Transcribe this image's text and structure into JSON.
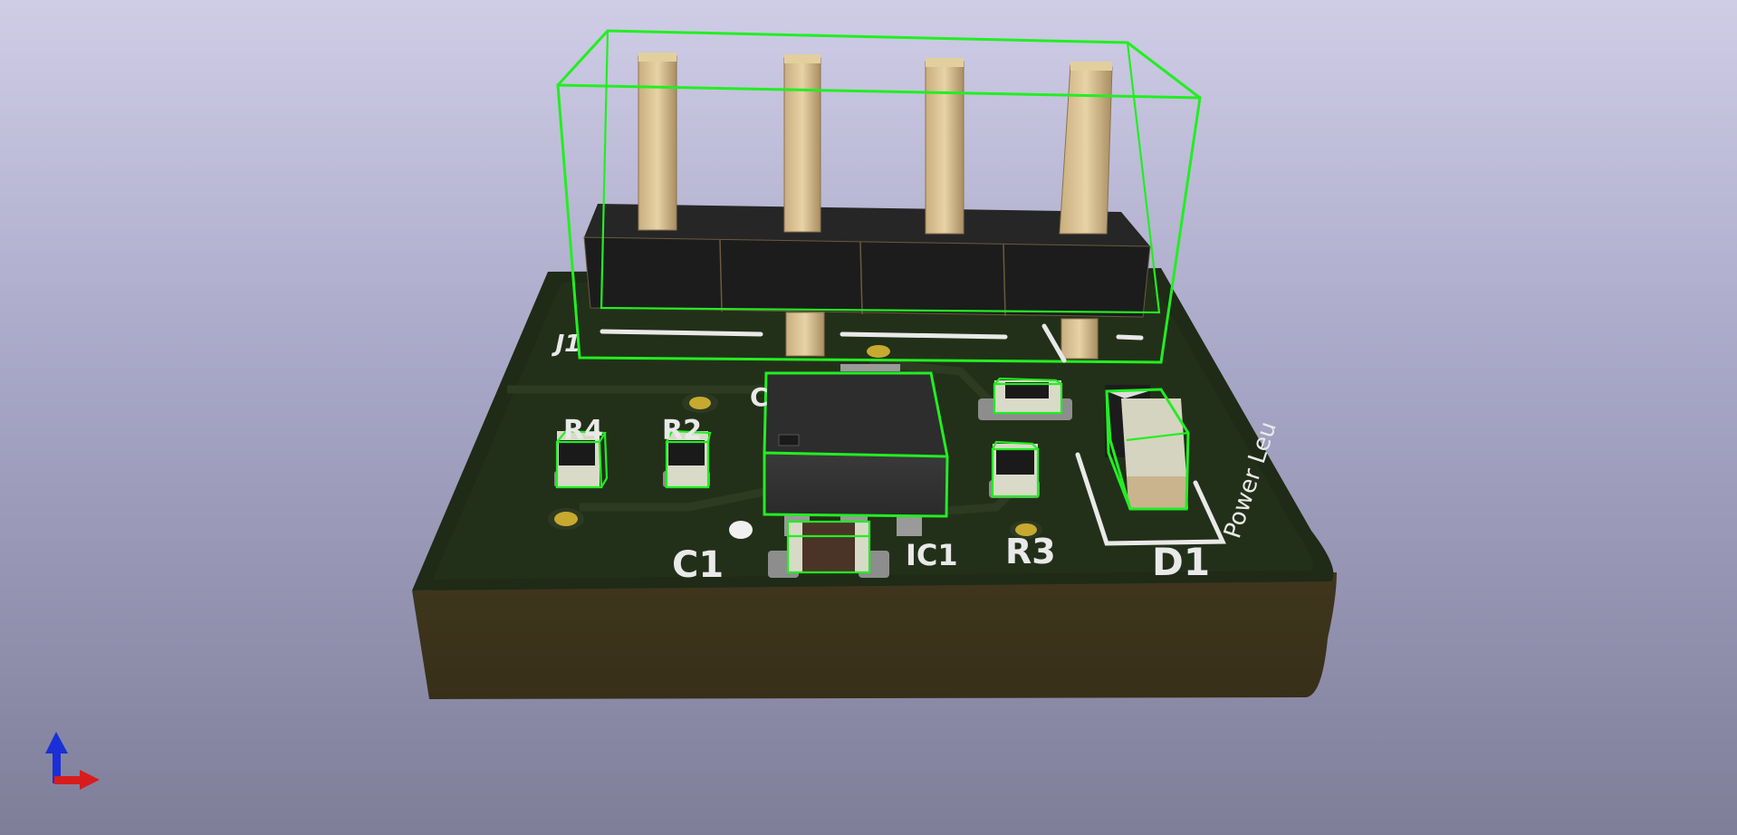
{
  "viewer": {
    "background_top": "#cfcde6",
    "background_bottom": "#7f7e99",
    "selection_color": "#22ee22",
    "pcb_mask_color": "#1f2a17",
    "pcb_edge_color": "#3e351c",
    "silkscreen_color": "#e9e9e9"
  },
  "silkscreen": {
    "j1": "J1",
    "r4": "R4",
    "r2": "R2",
    "c_partial": "C",
    "c1": "C1",
    "ic1": "IC1",
    "r3": "R3",
    "d1": "D1",
    "power_led": "Power Leu"
  },
  "axes": {
    "z_icon": "z-axis-arrow-icon",
    "x_icon": "x-axis-arrow-icon",
    "z_color": "#1a2fd6",
    "x_color": "#d81c1c"
  }
}
